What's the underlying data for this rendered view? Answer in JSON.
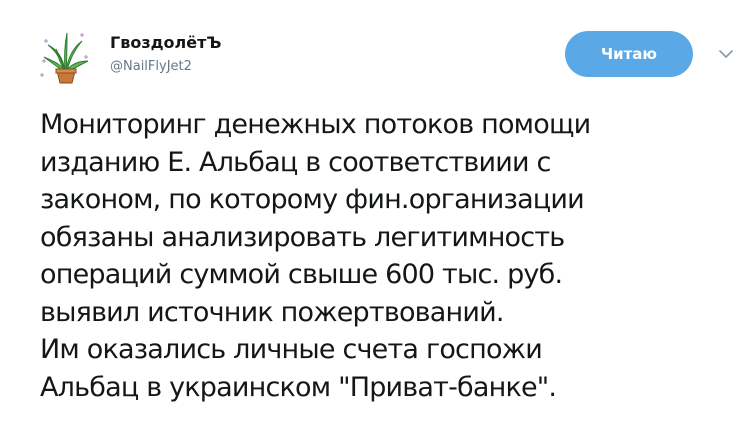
{
  "author": {
    "display_name": "ГвоздолётЪ",
    "handle": "@NailFlyJet2",
    "avatar_icon": "potted-plant-icon"
  },
  "follow_button": {
    "label": "Читаю",
    "color": "#5aa9e6"
  },
  "menu_icon": "chevron-down-icon",
  "tweet": {
    "text": "Мониторинг денежных потоков помощи\nизданию Е. Альбац в соответствиии с\nзаконом, по которому фин.организации\nобязаны анализировать легитимность\nопераций суммой свыше 600 тыс. руб.\nвыявил источник пожертвований.\nИм оказались личные счета госпожи\nАльбац в украинском \"Приват-банке\"."
  },
  "colors": {
    "text": "#14171a",
    "secondary": "#657786",
    "accent": "#5aa9e6"
  }
}
